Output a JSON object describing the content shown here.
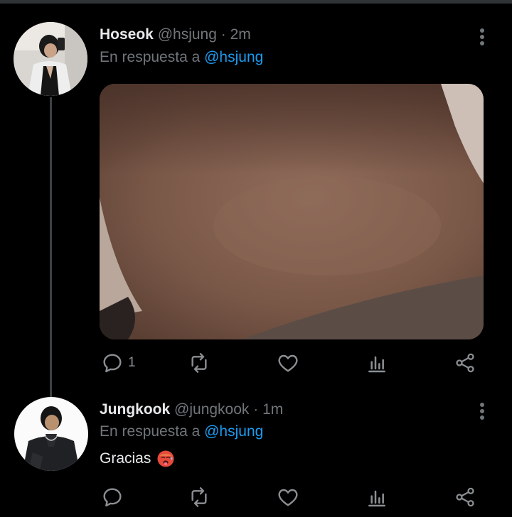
{
  "tweets": [
    {
      "name": "Hoseok",
      "handle": "@hsjung",
      "separator": "·",
      "time": "2m",
      "reply_prefix": "En respuesta a",
      "reply_to": "@hsjung",
      "reply_count": "1",
      "avatar_icon": "person-mirror-selfie-avatar",
      "media_icon": "photo-neck-closeup"
    },
    {
      "name": "Jungkook",
      "handle": "@jungkook",
      "separator": "·",
      "time": "1m",
      "reply_prefix": "En respuesta a",
      "reply_to": "@hsjung",
      "text": "Gracias",
      "emoji_icon": "hot-face-emoji",
      "avatar_icon": "person-dark-jacket-avatar"
    }
  ],
  "action_icons": [
    "reply-icon",
    "retweet-icon",
    "like-icon",
    "stats-icon",
    "share-icon"
  ],
  "colors": {
    "background": "#000000",
    "text": "#e7e9ea",
    "muted": "#71767b",
    "accent": "#1d9bf0",
    "thread_line": "#3e4144"
  }
}
